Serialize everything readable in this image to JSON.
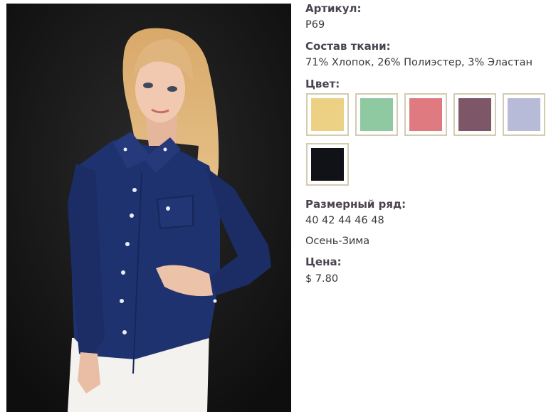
{
  "product": {
    "article_label": "Артикул:",
    "article_value": "P69",
    "composition_label": "Состав ткани:",
    "composition_value": "71% Хлопок, 26% Полиэстер, 3% Эластан",
    "color_label": "Цвет:",
    "colors": [
      {
        "name": "yellow-swatch",
        "hex": "#ecd185"
      },
      {
        "name": "mint-swatch",
        "hex": "#8ec9a2"
      },
      {
        "name": "pink-swatch",
        "hex": "#df7b80"
      },
      {
        "name": "mauve-swatch",
        "hex": "#7d5767"
      },
      {
        "name": "lavender-swatch",
        "hex": "#b7bbd8"
      },
      {
        "name": "black-swatch",
        "hex": "#111218"
      }
    ],
    "sizes_label": "Размерный ряд:",
    "sizes_value": "40 42 44 46 48",
    "season": "Осень-Зима",
    "price_label": "Цена:",
    "price_value": "$ 7.80"
  }
}
